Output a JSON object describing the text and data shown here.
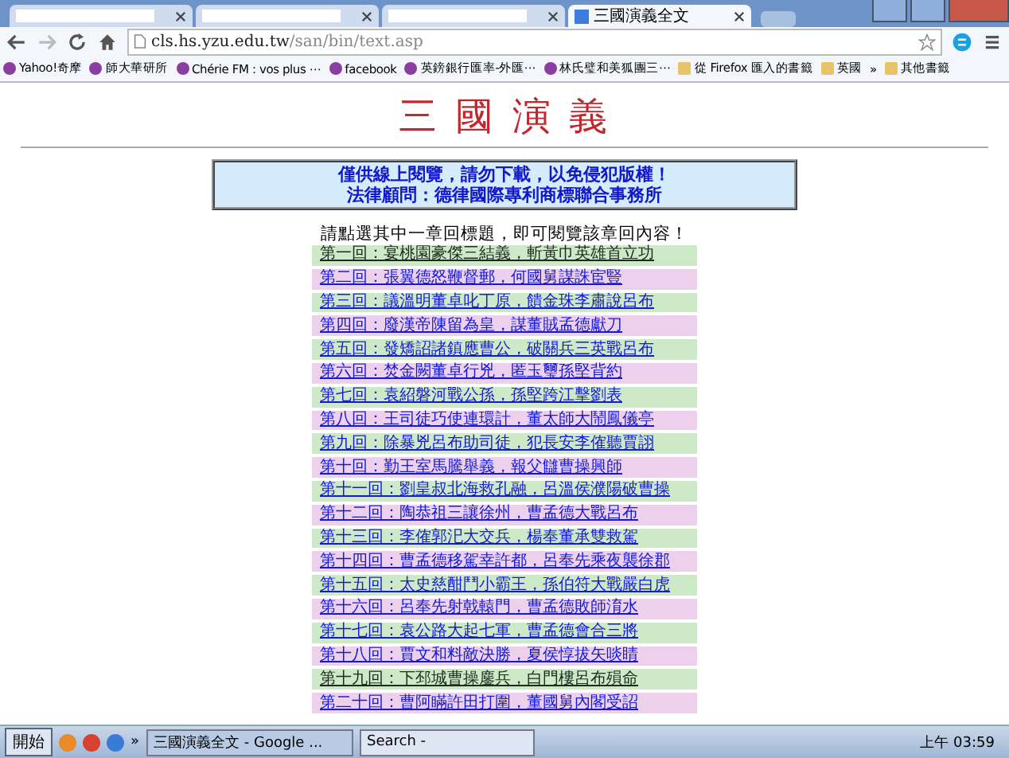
{
  "browser": {
    "tabs": [
      {
        "selected": false
      },
      {
        "selected": false
      },
      {
        "selected": false
      },
      {
        "title": "三國演義全文",
        "selected": true
      }
    ],
    "url_host": "cls.hs.yzu.edu.tw",
    "url_path": "/san/bin/text.asp",
    "bookmarks": [
      "Yahoo!奇摩",
      "師大華研所",
      "Chérie FM : vos plus ⋯",
      "facebook",
      "英鎊銀行匯率-外匯⋯",
      "林氏璧和美狐團三⋯",
      "從 Firefox 匯入的書籤",
      "英國"
    ],
    "more_bookmarks": "»",
    "other_bookmarks": "其他書籤"
  },
  "page": {
    "title": "三 國 演 義",
    "notice": [
      "僅供線上閱覽，請勿下載，以免侵犯版權！",
      "法律顧問：德律國際專利商標聯合事務所"
    ],
    "instruction": "請點選其中一章回標題，即可閱覽該章回內容！",
    "chapters": [
      {
        "title": "第一回：宴桃園豪傑三結義，斬黃巾英雄首立功",
        "visited": true
      },
      {
        "title": "第二回：張翼德怒鞭督郵，何國舅謀誅宦豎",
        "visited": false
      },
      {
        "title": "第三回：議溫明董卓叱丁原，饋金珠李肅說呂布",
        "visited": false
      },
      {
        "title": "第四回：廢漢帝陳留為皇，謀董賊孟德獻刀",
        "visited": false
      },
      {
        "title": "第五回：發矯詔諸鎮應曹公，破關兵三英戰呂布",
        "visited": false
      },
      {
        "title": "第六回：焚金闕董卓行兇，匿玉璽孫堅背約",
        "visited": false
      },
      {
        "title": "第七回：袁紹磐河戰公孫，孫堅跨江擊劉表",
        "visited": false
      },
      {
        "title": "第八回：王司徒巧使連環計，董太師大鬧鳳儀亭",
        "visited": false
      },
      {
        "title": "第九回：除暴兇呂布助司徒，犯長安李傕聽賈詡",
        "visited": false
      },
      {
        "title": "第十回：勤王室馬騰舉義，報父讎曹操興師",
        "visited": false
      },
      {
        "title": "第十一回：劉皇叔北海救孔融，呂溫侯濮陽破曹操",
        "visited": false
      },
      {
        "title": "第十二回：陶恭祖三讓徐州，曹孟德大戰呂布",
        "visited": false
      },
      {
        "title": "第十三回：李傕郭汜大交兵，楊奉董承雙救駕",
        "visited": false
      },
      {
        "title": "第十四回：曹孟德移駕幸許都，呂奉先乘夜襲徐郡",
        "visited": false
      },
      {
        "title": "第十五回：太史慈酣鬥小霸王，孫伯符大戰嚴白虎",
        "visited": false
      },
      {
        "title": "第十六回：呂奉先射戟轅門，曹孟德敗師淯水",
        "visited": false
      },
      {
        "title": "第十七回：袁公路大起七軍，曹孟德會合三將",
        "visited": false
      },
      {
        "title": "第十八回：賈文和料敵決勝，夏侯惇拔矢啖睛",
        "visited": false
      },
      {
        "title": "第十九回：下邳城曹操鏖兵，白門樓呂布殞命",
        "visited": true
      },
      {
        "title": "第二十回：曹阿瞞許田打圍，董國舅內閣受詔",
        "visited": false
      }
    ]
  },
  "taskbar": {
    "start": "開始",
    "more": "»",
    "tasks": [
      {
        "title": "三國演義全文 - Google ...",
        "selected": true
      },
      {
        "title": "Search - ",
        "selected": false
      }
    ],
    "clock": "上午 03:59"
  }
}
